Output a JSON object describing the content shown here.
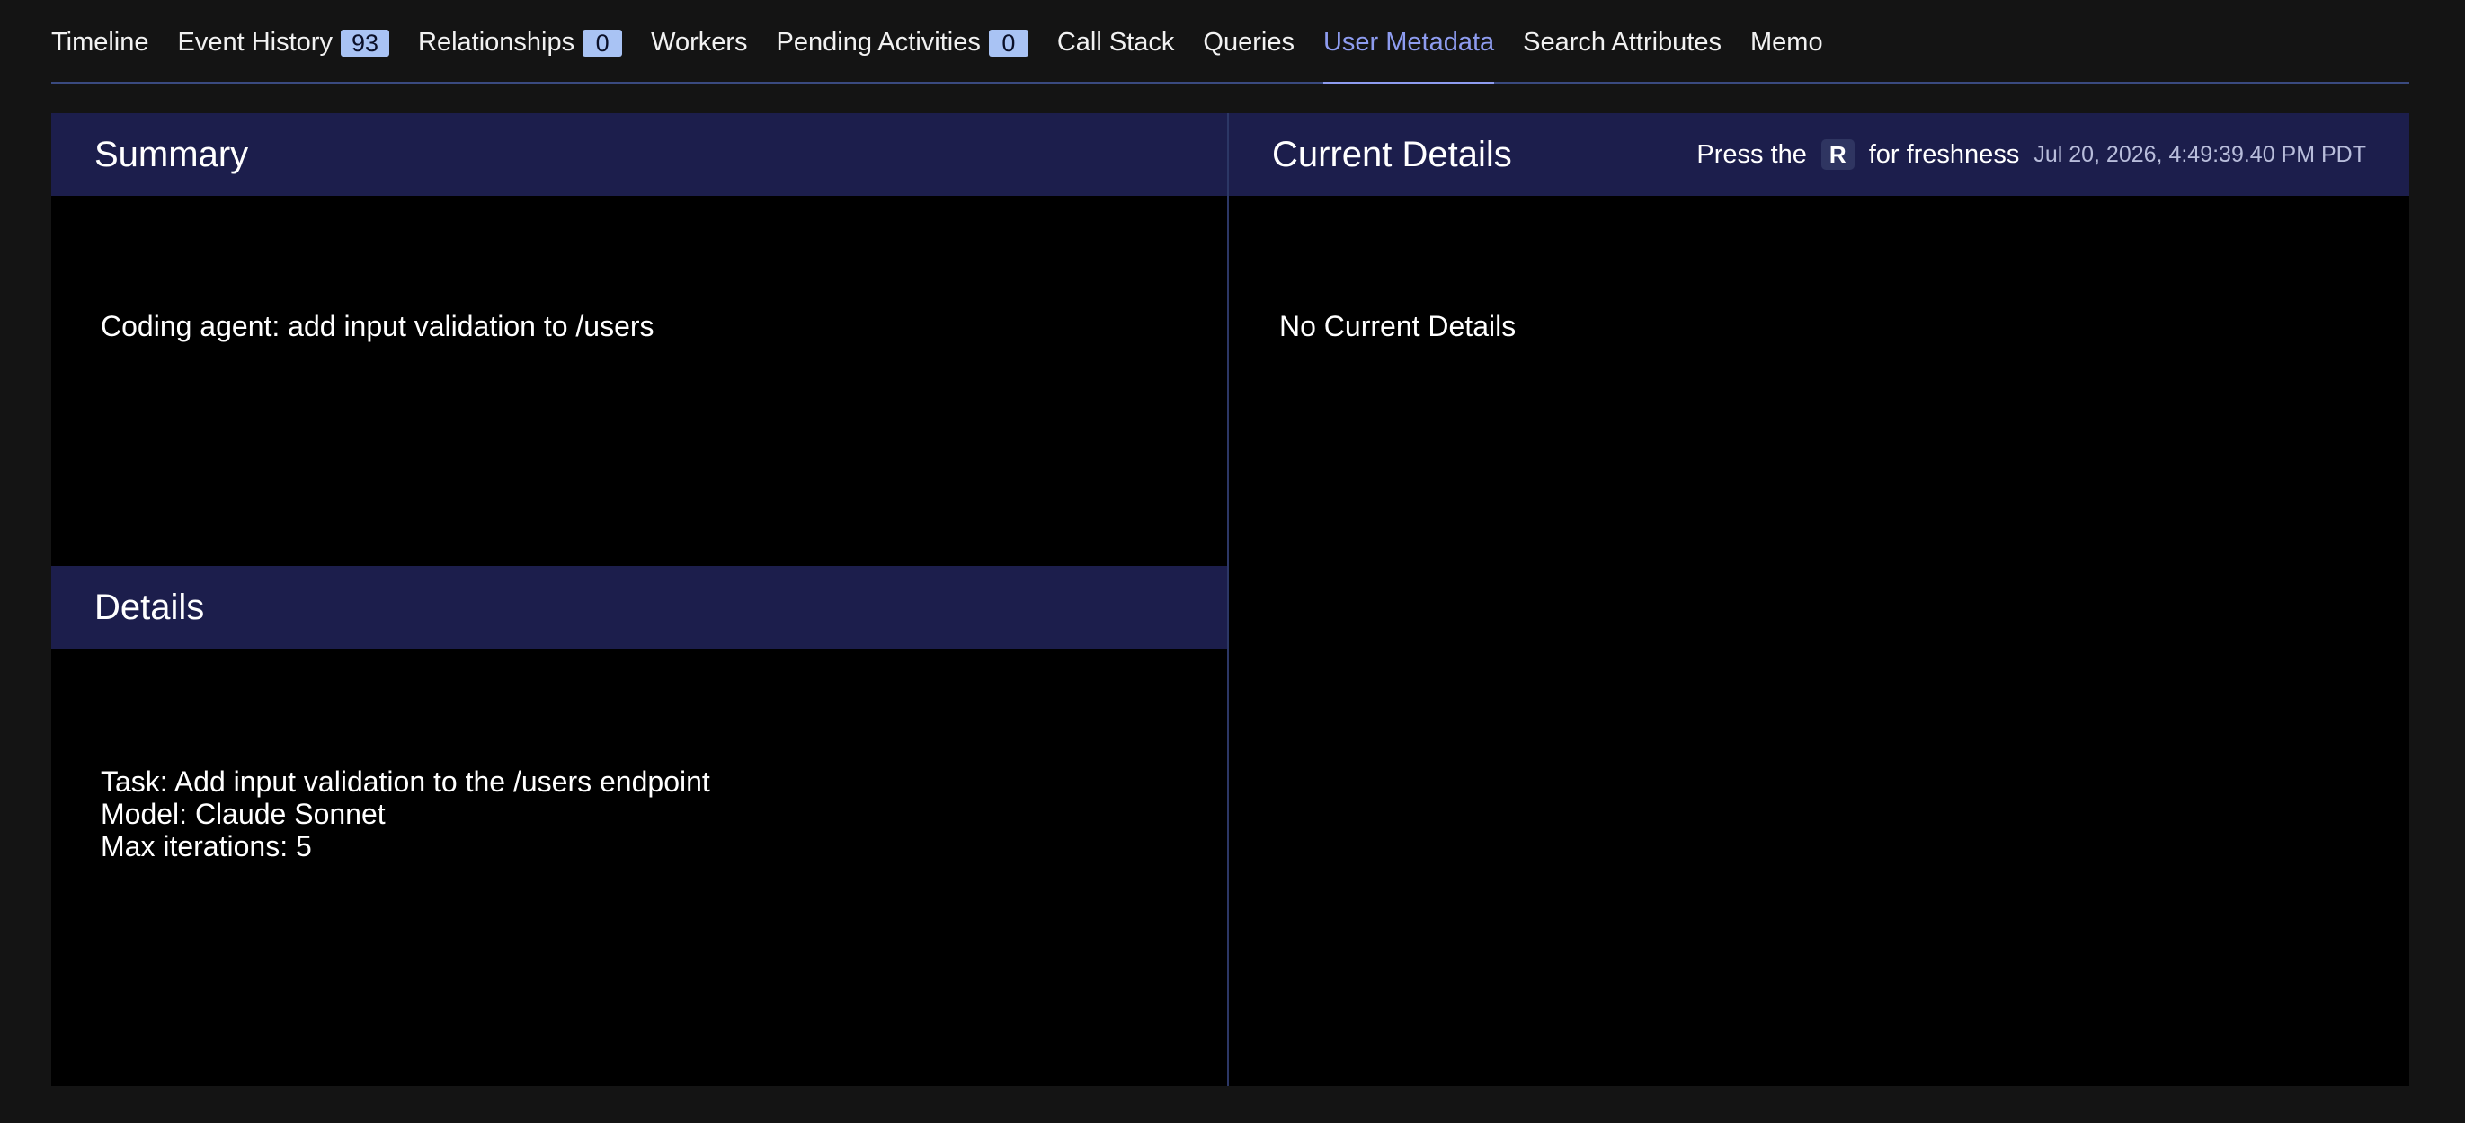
{
  "tabs": [
    {
      "label": "Timeline"
    },
    {
      "label": "Event History",
      "badge": "93"
    },
    {
      "label": "Relationships",
      "badge": "0"
    },
    {
      "label": "Workers"
    },
    {
      "label": "Pending Activities",
      "badge": "0"
    },
    {
      "label": "Call Stack"
    },
    {
      "label": "Queries"
    },
    {
      "label": "User Metadata",
      "active": true
    },
    {
      "label": "Search Attributes"
    },
    {
      "label": "Memo"
    }
  ],
  "colors": {
    "accent": "#8e9cf0",
    "badge_bg": "#a9c3f4",
    "header_bg": "#1c1e4c",
    "page_bg": "#141414",
    "panel_bg": "#000000"
  },
  "summary": {
    "title": "Summary",
    "text": "Coding agent: add input validation to /users"
  },
  "details": {
    "title": "Details",
    "lines": [
      "Task: Add input validation to the /users endpoint",
      "Model: Claude Sonnet",
      "Max iterations: 5"
    ]
  },
  "current_details": {
    "title": "Current Details",
    "press_prefix": "Press the",
    "key": "R",
    "press_suffix": "for freshness",
    "timestamp": "Jul 20, 2026, 4:49:39.40 PM PDT",
    "empty_text": "No Current Details"
  }
}
